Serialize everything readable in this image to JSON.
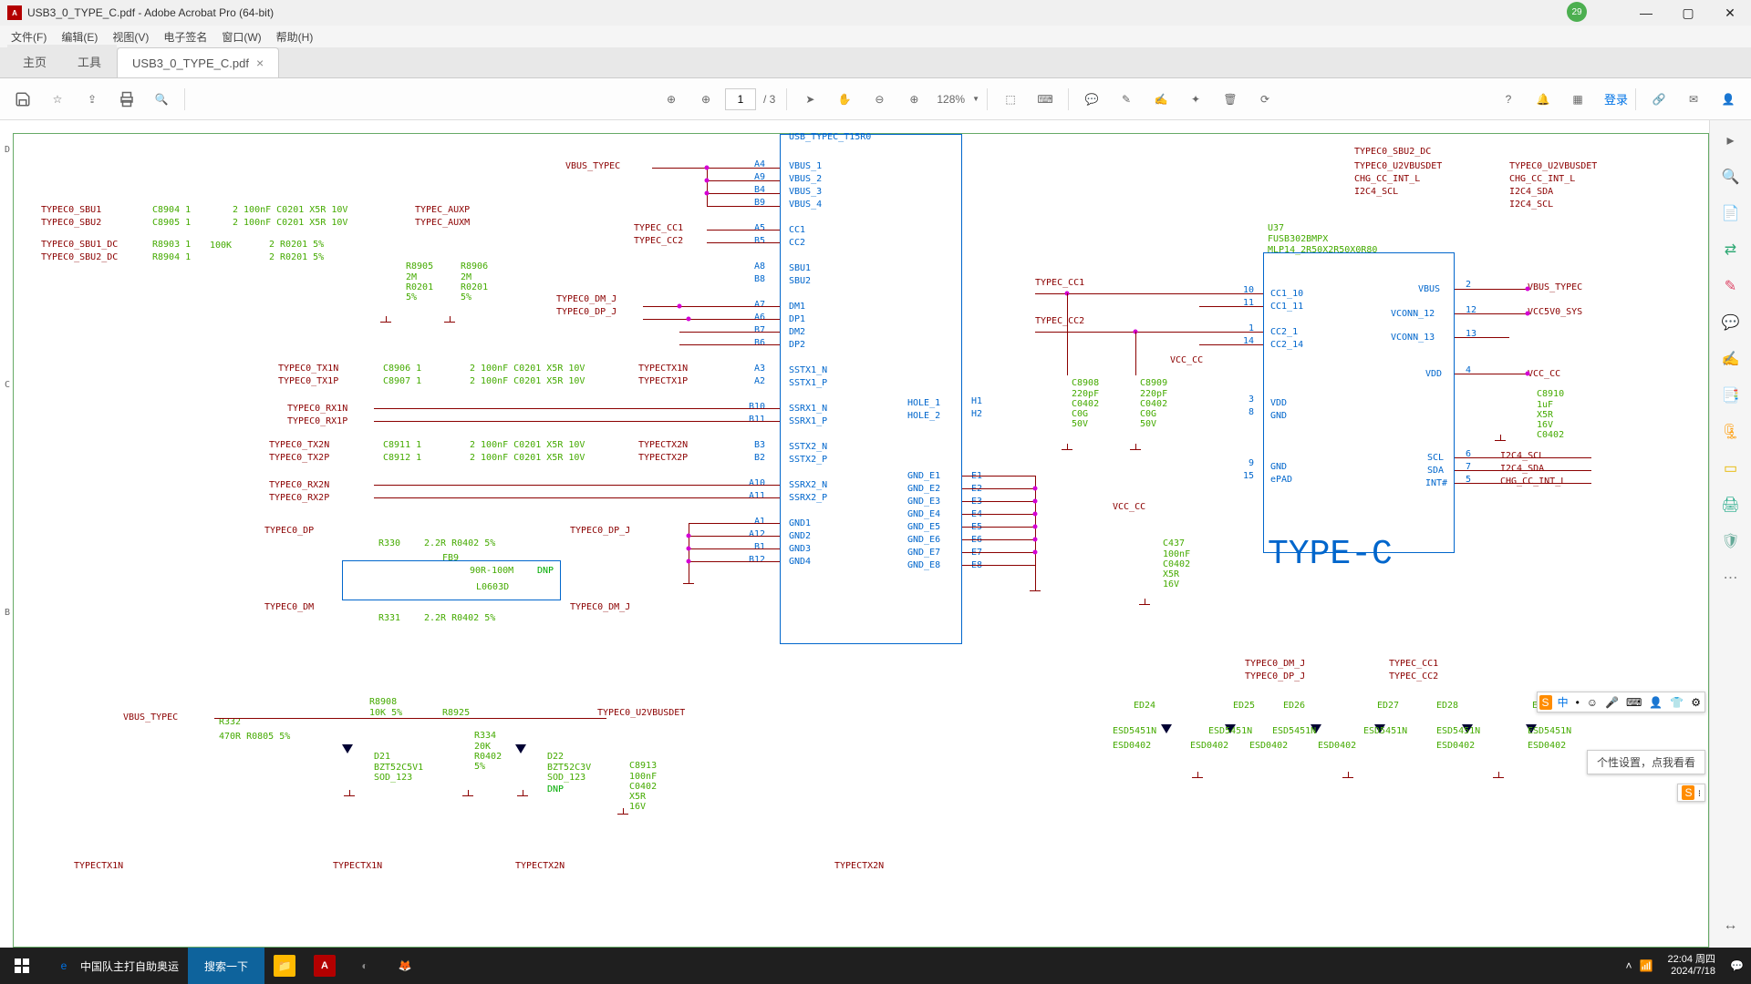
{
  "title": "USB3_0_TYPE_C.pdf - Adobe Acrobat Pro (64-bit)",
  "notif_count": "29",
  "menu": [
    "文件(F)",
    "编辑(E)",
    "视图(V)",
    "电子签名",
    "窗口(W)",
    "帮助(H)"
  ],
  "tabs": {
    "home": "主页",
    "tools": "工具",
    "doc": "USB3_0_TYPE_C.pdf"
  },
  "toolbar": {
    "page_current": "1",
    "page_total": "/ 3",
    "zoom": "128%",
    "login": "登录"
  },
  "tooltip": "个性设置，点我看看",
  "taskbar": {
    "edge_title": "中国队主打自助奥运",
    "search": "搜索一下",
    "time": "22:04 周四",
    "date": "2024/7/18"
  },
  "schematic": {
    "big_label": "TYPE-C",
    "u37_ref": "U37",
    "u37_part": "FUSB302BMPX",
    "u37_pkg": "MLP14_2R50X2R50X0R80",
    "main_conn_label": "USB_TYPEC_T15R0",
    "nets": {
      "vbus_typec": "VBUS_TYPEC",
      "typec0_sbu1": "TYPEC0_SBU1",
      "typec0_sbu2": "TYPEC0_SBU2",
      "typec0_sbu1_dc": "TYPEC0_SBU1_DC",
      "typec0_sbu2_dc": "TYPEC0_SBU2_DC",
      "typec_auxp": "TYPEC_AUXP",
      "typec_auxm": "TYPEC_AUXM",
      "typec_cc1": "TYPEC_CC1",
      "typec_cc2": "TYPEC_CC2",
      "typec0_dm_j": "TYPEC0_DM_J",
      "typec0_dp_j": "TYPEC0_DP_J",
      "typec0_tx1n": "TYPEC0_TX1N",
      "typec0_tx1p": "TYPEC0_TX1P",
      "typec0_rx1n": "TYPEC0_RX1N",
      "typec0_rx1p": "TYPEC0_RX1P",
      "typec0_tx2n": "TYPEC0_TX2N",
      "typec0_tx2p": "TYPEC0_TX2P",
      "typec0_rx2n": "TYPEC0_RX2N",
      "typec0_rx2p": "TYPEC0_RX2P",
      "typectx1n": "TYPECTX1N",
      "typectx1p": "TYPECTX1P",
      "typectx2n": "TYPECTX2N",
      "typectx2p": "TYPECTX2P",
      "typec0_dp": "TYPEC0_DP",
      "typec0_dm": "TYPEC0_DM",
      "typec0_u2vbusdet": "TYPEC0_U2VBUSDET",
      "hole1": "HOLE_1",
      "hole2": "HOLE_2",
      "vcc_cc": "VCC_CC",
      "vcc5v0_sys": "VCC5V0_SYS",
      "i2c4_scl": "I2C4_SCL",
      "i2c4_sda": "I2C4_SDA",
      "chg_cc_int_l": "CHG_CC_INT_L",
      "sbu2_dc_top": "TYPEC0_SBU2_DC"
    },
    "pins": {
      "vbus1": "VBUS_1",
      "vbus2": "VBUS_2",
      "vbus3": "VBUS_3",
      "vbus4": "VBUS_4",
      "cc1": "CC1",
      "cc2": "CC2",
      "sbu1": "SBU1",
      "sbu2": "SBU2",
      "dm1": "DM1",
      "dp1": "DP1",
      "dm2": "DM2",
      "dp2": "DP2",
      "sstx1n": "SSTX1_N",
      "sstx1p": "SSTX1_P",
      "ssrx1n": "SSRX1_N",
      "ssrx1p": "SSRX1_P",
      "sstx2n": "SSTX2_N",
      "sstx2p": "SSTX2_P",
      "ssrx2n": "SSRX2_N",
      "ssrx2p": "SSRX2_P",
      "gnd1": "GND1",
      "gnd2": "GND2",
      "gnd3": "GND3",
      "gnd4": "GND4",
      "gnd_e1": "GND_E1",
      "gnd_e2": "GND_E2",
      "gnd_e3": "GND_E3",
      "gnd_e4": "GND_E4",
      "gnd_e5": "GND_E5",
      "gnd_e6": "GND_E6",
      "gnd_e7": "GND_E7",
      "gnd_e8": "GND_E8",
      "u37_cc1_10": "CC1_10",
      "u37_cc1_11": "CC1_11",
      "u37_cc2_1": "CC2_1",
      "u37_cc2_14": "CC2_14",
      "u37_vdd": "VDD",
      "u37_gnd": "GND",
      "u37_epad": "ePAD",
      "u37_vbus": "VBUS",
      "u37_vconn12": "VCONN_12",
      "u37_vconn13": "VCONN_13",
      "u37_vdd_r": "VDD",
      "u37_scl": "SCL",
      "u37_sda": "SDA",
      "u37_int": "INT#"
    },
    "pin_nums": {
      "a4": "A4",
      "a9": "A9",
      "b4": "B4",
      "b9": "B9",
      "a5": "A5",
      "b5": "B5",
      "a8": "A8",
      "b8": "B8",
      "a7": "A7",
      "a6": "A6",
      "b7": "B7",
      "b6": "B6",
      "a3": "A3",
      "a2": "A2",
      "b10": "B10",
      "b11": "B11",
      "b3": "B3",
      "b2": "B2",
      "a10": "A10",
      "a11": "A11",
      "a1": "A1",
      "a12": "A12",
      "b1": "B1",
      "b12": "B12",
      "h1": "H1",
      "h2": "H2",
      "e1": "E1",
      "e2": "E2",
      "e3": "E3",
      "e4": "E4",
      "e5": "E5",
      "e6": "E6",
      "e7": "E7",
      "e8": "E8",
      "p10": "10",
      "p11": "11",
      "p1": "1",
      "p14": "14",
      "p3": "3",
      "p8": "8",
      "p9": "9",
      "p15": "15",
      "p2": "2",
      "p12": "12",
      "p13": "13",
      "p4": "4",
      "p6": "6",
      "p7": "7",
      "p5": "5"
    },
    "components": {
      "r8905": "R8905",
      "r8905_val": "2M\nR0201\n5%",
      "r8906": "R8906",
      "r8906_val": "2M\nR0201\n5%",
      "c8904": "C8904 1",
      "c8905": "C8905 1",
      "r8903": "R8903 1",
      "r8904": "R8904 1",
      "c8906": "C8906 1",
      "c8907": "C8907 1",
      "c8911": "C8911 1",
      "c8912": "C8912 1",
      "c8908": "C8908",
      "c8908_val": "220pF\nC0402\nC0G\n50V",
      "c8909": "C8909",
      "c8909_val": "220pF\nC0402\nC0G\n50V",
      "c8910": "C8910",
      "c8910_val": "1uF\nX5R\n16V\nC0402",
      "c437": "C437",
      "c437_val": "100nF\nC0402\nX5R\n16V",
      "r330": "R330",
      "r330_val": "2.2R R0402 5%",
      "r331": "R331",
      "r331_val": "2.2R R0402 5%",
      "fb9": "FB9",
      "fb9_val": "90R-100M",
      "dnp": "DNP",
      "l0603d": "L0603D",
      "r332": "R332",
      "r332_val": "470R  R0805   5%",
      "r8908": "R8908",
      "r8908_val": "10K 5%",
      "r8925": "R8925",
      "r334": "R334",
      "r334_val": "20K\nR0402\n5%",
      "d21": "D21",
      "d21_val": "BZT52C5V1\nSOD_123",
      "d22": "D22",
      "d22_val": "BZT52C3V\nSOD_123",
      "c8913": "C8913",
      "c8913_val": "100nF\nC0402\nX5R\n16V",
      "cap_spec": "2   100nF  C0201 X5R 10V",
      "res_spec": "2   R0201 5%",
      "r100k": "100K",
      "ed24": "ED24",
      "ed25": "ED25",
      "ed26": "ED26",
      "ed27": "ED27",
      "ed28": "ED28",
      "ed29": "ED29",
      "esd5451n": "ESD5451N",
      "esd0402": "ESD0402"
    }
  }
}
